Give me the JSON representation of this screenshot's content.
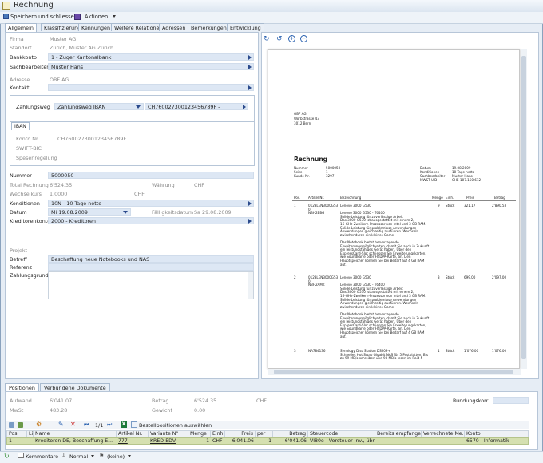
{
  "window": {
    "title": "Rechnung"
  },
  "toolbar": {
    "save_close": "Speichern und schliessen",
    "actions": "Aktionen"
  },
  "tabs": [
    "Allgemein",
    "Klassifizierung",
    "Kennungen",
    "Weitere Relationen",
    "Adressen",
    "Bemerkungen",
    "Entwicklung"
  ],
  "form": {
    "firma": {
      "label": "Firma",
      "value": "Muster AG"
    },
    "standort": {
      "label": "Standort",
      "value": "Zürich, Muster AG Zürich"
    },
    "bankkonto": {
      "label": "Bankkonto",
      "value": "1 - Zuger Kantonalbank"
    },
    "sachbearbeiter": {
      "label": "Sachbearbeiter",
      "value": "Muster Hans"
    },
    "adresse": {
      "label": "Adresse",
      "value": "OBF AG"
    },
    "kontakt": {
      "label": "Kontakt",
      "value": ""
    },
    "zahlungsweg": {
      "label": "Zahlungsweg",
      "value": "Zahlungsweg IBAN",
      "konto": "CH760027300123456789F -"
    },
    "iban_tab": "IBAN",
    "konto_nr": {
      "label": "Konto Nr.",
      "value": "CH760027300123456789F"
    },
    "swift": {
      "label": "SWIFT-BIC",
      "value": ""
    },
    "spesen": {
      "label": "Spesenregelung",
      "value": ""
    },
    "nummer": {
      "label": "Nummer",
      "value": "5000050"
    },
    "total": {
      "label": "Total Rechnung",
      "value": "6'524.35"
    },
    "waehrung": {
      "label": "Währung",
      "value": "CHF"
    },
    "wechselkurs": {
      "label": "Wechselkurs",
      "value": "1.0000",
      "unit": "CHF"
    },
    "konditionen": {
      "label": "Konditionen",
      "value": "10N - 10 Tage netto"
    },
    "datum": {
      "label": "Datum",
      "value": "Mi 19.08.2009"
    },
    "faelligkeit": {
      "label": "Fälligkeitsdatum",
      "value": "Sa 29.08.2009"
    },
    "kreditorenkonto": {
      "label": "Kreditorenkonto",
      "value": "2000 - Kreditoren"
    },
    "projekt": {
      "label": "Projekt",
      "value": ""
    },
    "betreff": {
      "label": "Betreff",
      "value": "Beschaffung neue Notebooks und NAS"
    },
    "referenz": {
      "label": "Referenz",
      "value": ""
    },
    "zahlungsgrund": {
      "label": "Zahlungsgrund",
      "value": ""
    }
  },
  "document": {
    "sender": [
      "OBF AG",
      "Worbstrasse 43",
      "3012 Bern"
    ],
    "heading": "Rechnung",
    "meta_left": [
      [
        "Nummer",
        "5000050"
      ],
      [
        "Seite",
        "1"
      ],
      [
        "Kunde Nr.",
        "3297"
      ]
    ],
    "meta_right": [
      [
        "Datum",
        "19.08.2009"
      ],
      [
        "Konditionen",
        "10 Tage netto"
      ],
      [
        "Sachbearbeiter",
        "Muster Hans"
      ],
      [
        "MWST UID",
        "CHE-107.150.612"
      ]
    ],
    "columns": [
      "Pos.",
      "Artikel Nr.",
      "Bezeichnung",
      "Menge",
      "Einh.",
      "Preis",
      "Betrag"
    ],
    "items": [
      {
        "pos": "1",
        "art": [
          "0123LEN3000G53",
          "0",
          "NBH2BBG"
        ],
        "desc": [
          "Lenovo 3000 G530",
          "",
          "Lenovo 3000 G530 - T6400",
          "Solide Leistung für zuverlässige Arbeit",
          "Das 3000 G530 ist ausgestattet mit einem 2,",
          "16-GHz-Zweikern-Prozessor von Intel und 3 GB RAM.",
          "Solide Leistung für problemlose Anwendungen",
          "Anwendungen gleichzeitig ausführen. Wechseln",
          "zwischendurch ein kleines Game.",
          "",
          "Das Notebook bietet hervorragende",
          "Erweiterungsmöglichkeiten, damit Sie auch in Zukunft",
          "ein leistungsfähiges Gerät haben. Über den",
          "ExpressCard-Slot schliessen Sie Erweiterungskarten,",
          "wie Soundkarte oder HSDPA-Karte, an. Den",
          "Hauptspeicher können Sie bei Bedarf auf 4 GB RAM",
          "auf."
        ],
        "qty": "9",
        "unit": "Stück",
        "price": "321.17",
        "amount": "2'890.53"
      },
      {
        "pos": "2",
        "art": [
          "0123LEN3000G53",
          "0",
          "NBH2AMZ"
        ],
        "desc": [
          "Lenovo 3000 G530",
          "",
          "Lenovo 3000 G530 - T6400",
          "Solide Leistung für zuverlässige Arbeit",
          "Das 3000 G530 ist ausgestattet mit einem 2,",
          "16-GHz-Zweikern-Prozessor von Intel und 3 GB RAM.",
          "Solide Leistung für problemlose Anwendungen",
          "Anwendungen gleichzeitig ausführen. Wechseln",
          "zwischendurch ein kleines Game.",
          "",
          "Das Notebook bietet hervorragende",
          "Erweiterungsmöglichkeiten, damit Sie auch in Zukunft",
          "ein leistungsfähiges Gerät haben. Über den",
          "ExpressCard-Slot schliessen Sie Erweiterungskarten,",
          "wie Soundkarte oder HSDPA-Karte, an. Den",
          "Hauptspeicher können Sie bei Bedarf auf 4 GB RAM",
          "auf."
        ],
        "qty": "3",
        "unit": "Stück",
        "price": "699.00",
        "amount": "2'097.00"
      },
      {
        "pos": "3",
        "art": [
          "NA784136"
        ],
        "desc": [
          "Synology Disc Station DS509+",
          "Schnelles Hot Swap Gigabit NAS für 5 Festplatten. Bis",
          "zu 99 MB/s schreiben und 93 MB/s lesen im Raid 5"
        ],
        "qty": "1",
        "unit": "Stück",
        "price": "1'076.00",
        "amount": "1'076.00"
      }
    ]
  },
  "bottom_tabs": [
    "Positionen",
    "Verbundene Dokumente"
  ],
  "summary": {
    "aufwand": {
      "label": "Aufwand",
      "value": "6'041.07"
    },
    "mwst": {
      "label": "MwSt",
      "value": "483.28"
    },
    "betrag": {
      "label": "Betrag",
      "value": "6'524.35",
      "unit": "CHF"
    },
    "gewicht": {
      "label": "Gewicht",
      "value": "0.00"
    },
    "rundung": {
      "label": "Rundungskorr.",
      "value": ""
    }
  },
  "grid": {
    "page": "1/1",
    "order_btn": "Bestellpositionen auswählen",
    "headers": [
      "Pos.",
      "Li",
      "Name",
      "Artikel Nr.",
      "Variante N°",
      "Menge",
      "Einh.",
      "Preis",
      "per",
      "Betrag",
      "Steuercode",
      "Bereits empfangen",
      "Verrechnete Me...",
      "Konto"
    ],
    "row": [
      "1",
      "",
      "Kreditoren DE, Beschaffung E...",
      "777",
      "KRED-EDV",
      "1",
      "CHF",
      "6'041.06",
      "1",
      "6'041.06",
      "VI80e - Vorsteuer Inv., übri...",
      "",
      "",
      "6570 - Informatik"
    ]
  },
  "status": {
    "comments": "Kommentare",
    "priority": "Normal",
    "flag": "(keine)"
  }
}
